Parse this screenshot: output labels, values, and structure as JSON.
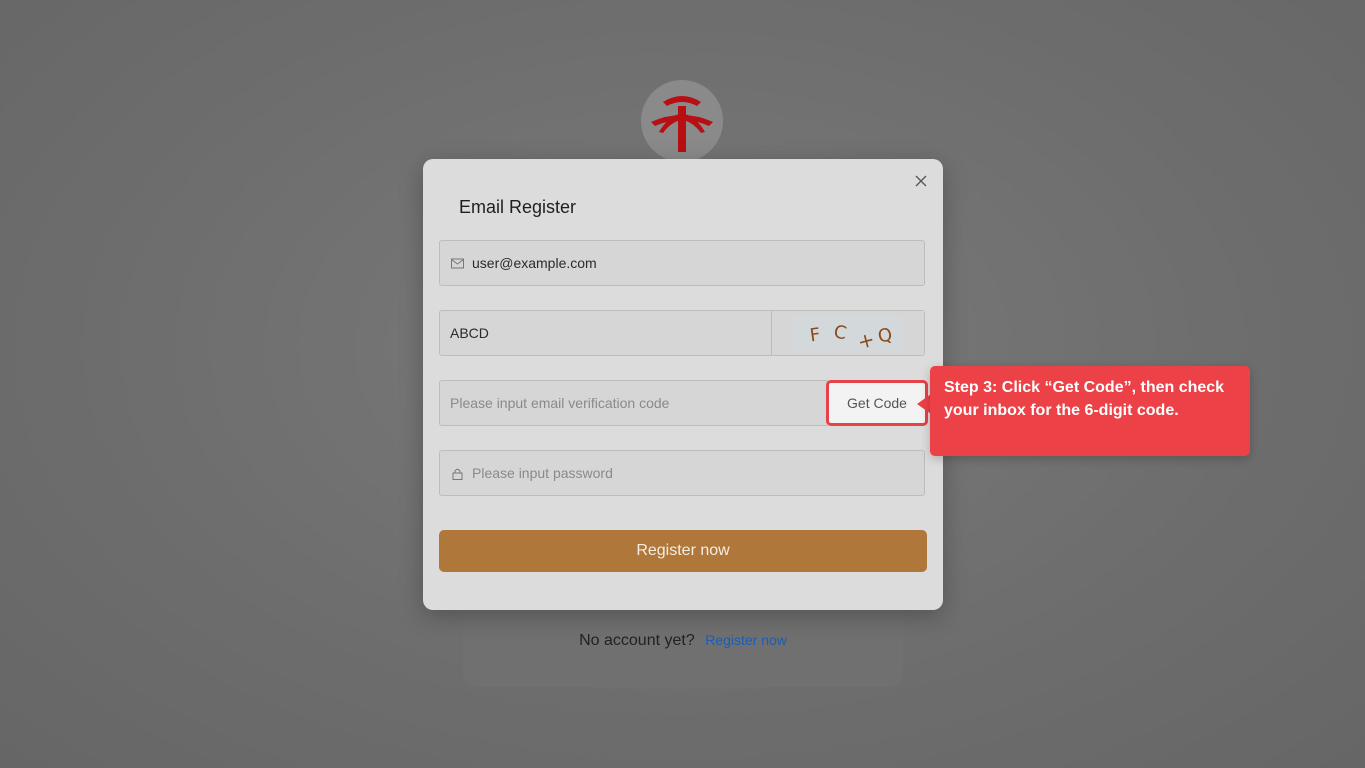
{
  "background": {
    "logo_name": "red-character-logo",
    "footer_text": "No account yet?",
    "footer_link": "Register now"
  },
  "modal": {
    "title": "Email Register",
    "email_value": "user@example.com",
    "captcha_value": "ABCD",
    "captcha_image_text": "F C +Q",
    "verification_placeholder": "Please input email verification code",
    "get_code_label": "Get Code",
    "password_placeholder": "Please input password",
    "register_label": "Register now"
  },
  "callout": {
    "text": "Step 3: Click “Get Code”, then check your inbox for the 6-digit code."
  },
  "colors": {
    "accent": "#b0773a",
    "callout": "#ec4146",
    "link": "#1a5fb4"
  }
}
